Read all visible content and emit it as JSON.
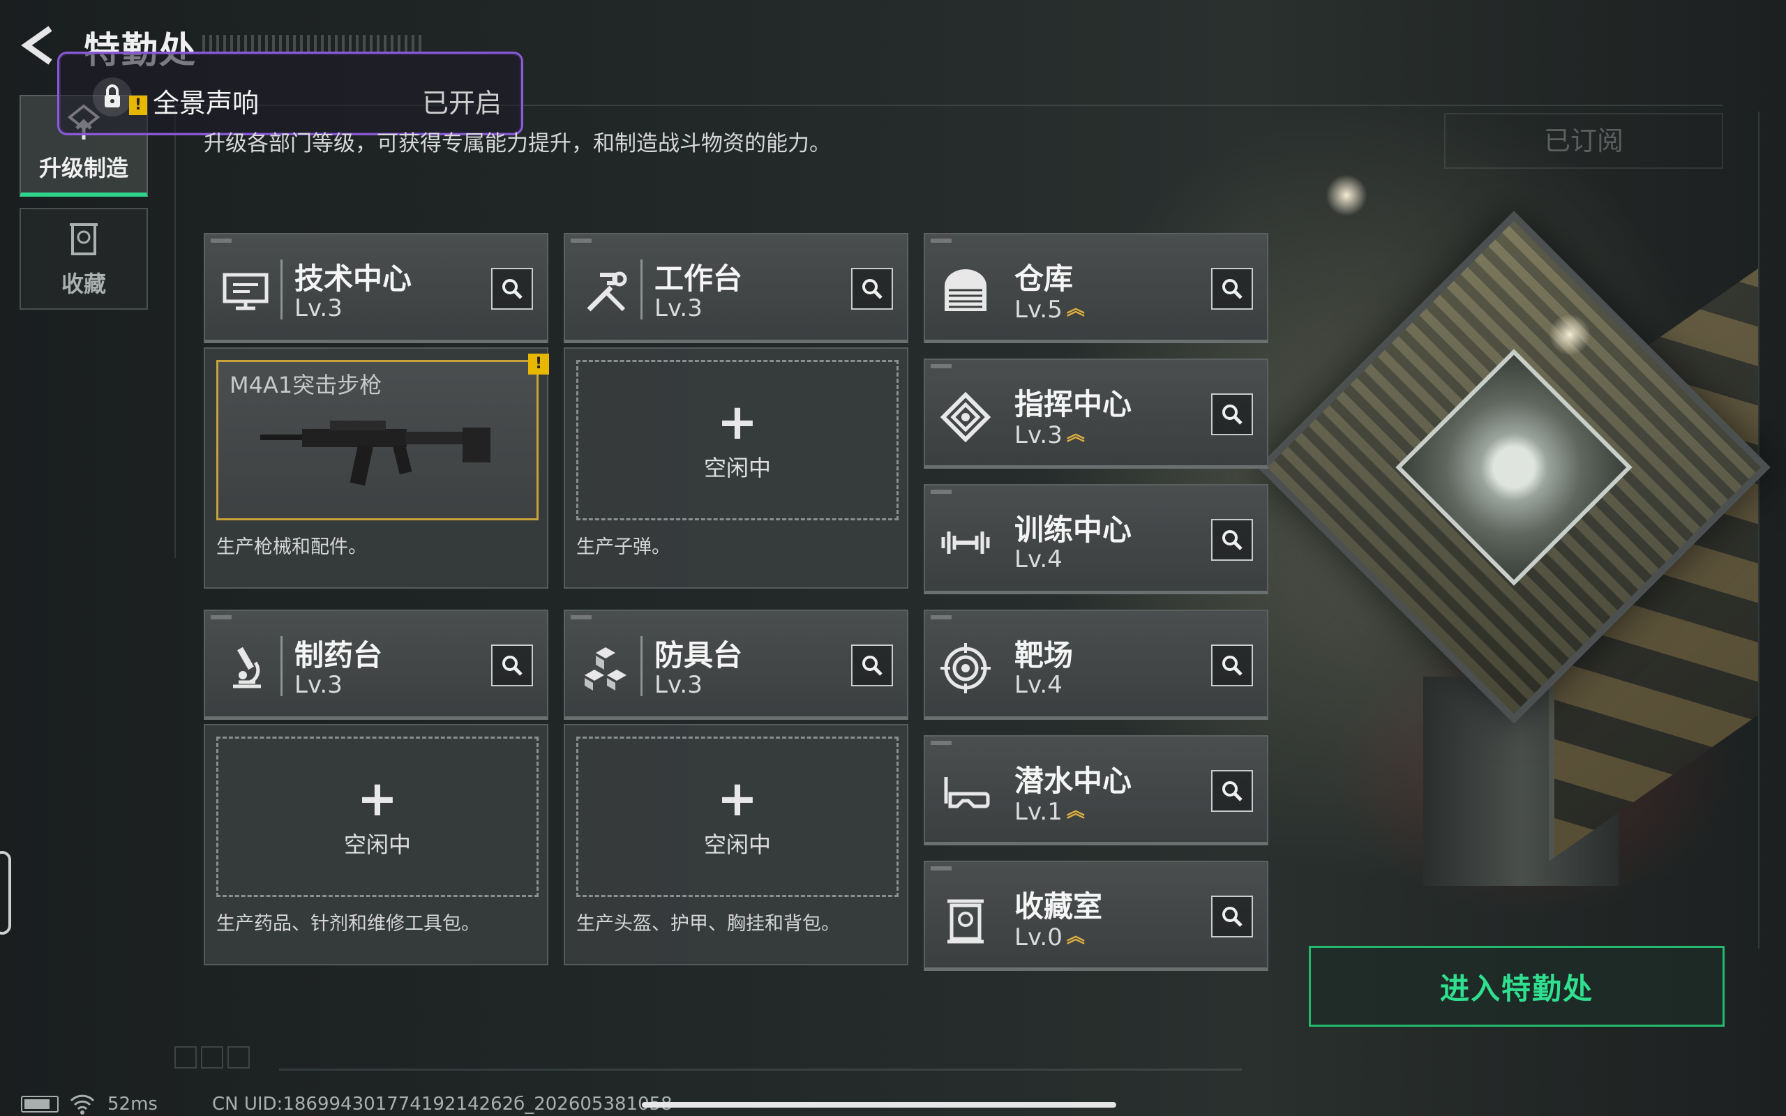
{
  "header": {
    "title": "特勤处",
    "subtitle": "升级各部门等级，可获得专属能力提升，和制造战斗物资的能力。",
    "subscribed_label": "已订阅"
  },
  "sound_popup": {
    "label": "全景声响",
    "status": "已开启",
    "warn_mark": "!"
  },
  "side_tabs": [
    {
      "label": "升级制造",
      "icon": "upgrade-icon",
      "active": true
    },
    {
      "label": "收藏",
      "icon": "collection-icon",
      "active": false
    }
  ],
  "departments": [
    {
      "name": "技术中心",
      "level": "Lv.3",
      "icon": "computer-icon",
      "upgradable": false,
      "slot": {
        "state": "busy",
        "item": "M4A1突击步枪",
        "warn": "!"
      },
      "desc": "生产枪械和配件。"
    },
    {
      "name": "工作台",
      "level": "Lv.3",
      "icon": "tools-icon",
      "upgradable": false,
      "slot": {
        "state": "idle",
        "plus": "+",
        "text": "空闲中"
      },
      "desc": "生产子弹。"
    },
    {
      "name": "制药台",
      "level": "Lv.3",
      "icon": "microscope-icon",
      "upgradable": false,
      "slot": {
        "state": "idle",
        "plus": "+",
        "text": "空闲中"
      },
      "desc": "生产药品、针剂和维修工具包。"
    },
    {
      "name": "防具台",
      "level": "Lv.3",
      "icon": "armor-boxes-icon",
      "upgradable": false,
      "slot": {
        "state": "idle",
        "plus": "+",
        "text": "空闲中"
      },
      "desc": "生产头盔、护甲、胸挂和背包。"
    }
  ],
  "facilities": [
    {
      "name": "仓库",
      "level": "Lv.5",
      "icon": "warehouse-icon",
      "upgradable": true
    },
    {
      "name": "指挥中心",
      "level": "Lv.3",
      "icon": "command-icon",
      "upgradable": true
    },
    {
      "name": "训练中心",
      "level": "Lv.4",
      "icon": "dumbbell-icon",
      "upgradable": false
    },
    {
      "name": "靶场",
      "level": "Lv.4",
      "icon": "target-icon",
      "upgradable": false
    },
    {
      "name": "潜水中心",
      "level": "Lv.1",
      "icon": "diving-mask-icon",
      "upgradable": true
    },
    {
      "name": "收藏室",
      "level": "Lv.0",
      "icon": "collection-room-icon",
      "upgradable": true
    }
  ],
  "upgrade_mark": "︽",
  "enter_button": {
    "label": "进入特勤处"
  },
  "status_bar": {
    "ping": "52ms",
    "uid": "CN UID:18699430177419214262б_202605381058"
  },
  "colors": {
    "accent_green": "#2fe08f",
    "active_tab_bar": "#2fd48c",
    "warn_yellow": "#e8b800",
    "popup_border": "#8a5ad8",
    "slot_filled_border": "#c9a23a"
  }
}
